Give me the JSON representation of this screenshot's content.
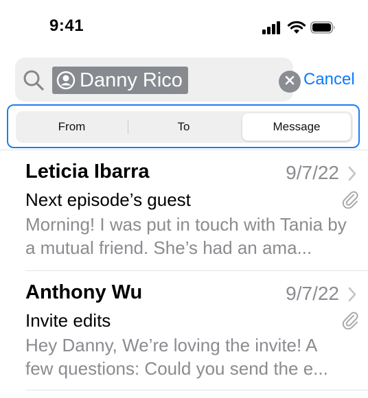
{
  "status_bar": {
    "time": "9:41"
  },
  "search": {
    "token_label": "Danny Rico",
    "cancel_label": "Cancel"
  },
  "scope": {
    "segments": [
      "From",
      "To",
      "Message"
    ],
    "selected": "Message"
  },
  "messages": [
    {
      "sender": "Leticia Ibarra",
      "date": "9/7/22",
      "subject": "Next episode’s guest",
      "preview": "Morning! I was put in touch with Tania by a mutual friend. She’s had an ama...",
      "has_attachment": true
    },
    {
      "sender": "Anthony Wu",
      "date": "9/7/22",
      "subject": "Invite edits",
      "preview": "Hey Danny, We’re loving the invite! A few questions: Could you send the e...",
      "has_attachment": true
    }
  ],
  "colors": {
    "accent": "#0a7aff",
    "secondary_text": "#8b8b90",
    "token_bg": "#878b90"
  },
  "icons": [
    "signal-icon",
    "wifi-icon",
    "battery-icon",
    "search-icon",
    "person-circle-icon",
    "clear-icon",
    "chevron-right-icon",
    "paperclip-icon"
  ]
}
